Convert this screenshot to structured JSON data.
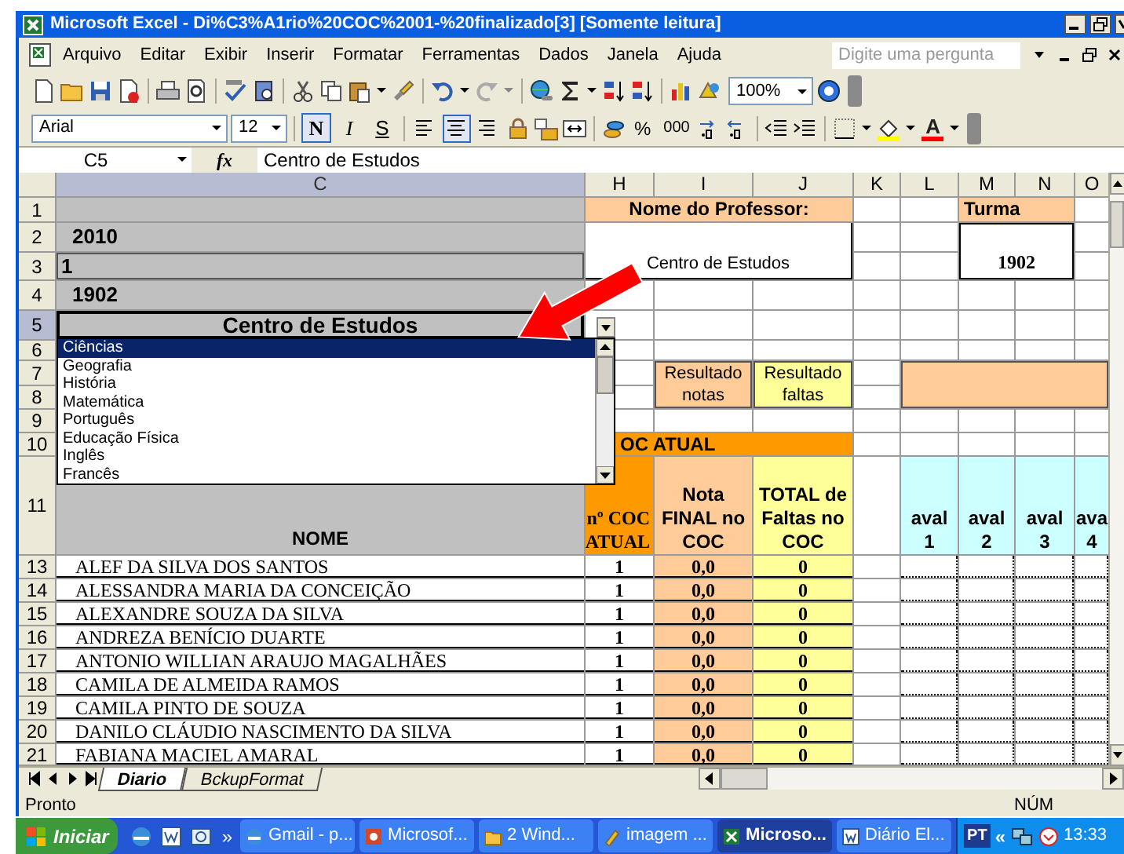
{
  "window": {
    "title": "Microsoft Excel - Di%C3%A1rio%20COC%2001-%20finalizado[3]  [Somente leitura]"
  },
  "menu": [
    "Arquivo",
    "Editar",
    "Exibir",
    "Inserir",
    "Formatar",
    "Ferramentas",
    "Dados",
    "Janela",
    "Ajuda"
  ],
  "help_box": {
    "placeholder": "Digite uma pergunta"
  },
  "standard_toolbar": {
    "zoom": "100%"
  },
  "format_toolbar": {
    "font": "Arial",
    "size": "12",
    "styles": [
      {
        "label": "N",
        "selected": true
      },
      {
        "label": "I",
        "selected": false
      },
      {
        "label": "S",
        "selected": false
      }
    ],
    "alignment": [
      {
        "selected": false
      },
      {
        "selected": true
      },
      {
        "selected": false
      }
    ],
    "percent": "%",
    "thousands": "000",
    "font_color": "A"
  },
  "formula_bar": {
    "name_box": "C5",
    "fx": "fx",
    "content": "Centro de Estudos"
  },
  "sheet": {
    "columns": [
      {
        "label": "C",
        "selected": true
      },
      {
        "label": "H",
        "selected": false
      },
      {
        "label": "I",
        "selected": false
      },
      {
        "label": "J",
        "selected": false
      },
      {
        "label": "K",
        "selected": false
      },
      {
        "label": "L",
        "selected": false
      },
      {
        "label": "M",
        "selected": false
      },
      {
        "label": "N",
        "selected": false
      },
      {
        "label": "O",
        "selected": false
      }
    ],
    "row_headers": [
      {
        "label": "1",
        "selected": false
      },
      {
        "label": "2",
        "selected": false
      },
      {
        "label": "3",
        "selected": false
      },
      {
        "label": "4",
        "selected": false
      },
      {
        "label": "5",
        "selected": true
      },
      {
        "label": "6",
        "selected": false
      },
      {
        "label": "7",
        "selected": false
      },
      {
        "label": "8",
        "selected": false
      },
      {
        "label": "9",
        "selected": false
      },
      {
        "label": "10",
        "selected": false
      },
      {
        "label": "11",
        "selected": false
      },
      {
        "label": "13",
        "selected": false
      },
      {
        "label": "14",
        "selected": false
      },
      {
        "label": "15",
        "selected": false
      },
      {
        "label": "16",
        "selected": false
      },
      {
        "label": "17",
        "selected": false
      },
      {
        "label": "18",
        "selected": false
      },
      {
        "label": "19",
        "selected": false
      },
      {
        "label": "20",
        "selected": false
      },
      {
        "label": "21",
        "selected": false
      }
    ],
    "year": "2010",
    "coc": "1",
    "class_code": "1902",
    "subject": "Centro de Estudos",
    "teacher_label": "Nome do Professor:",
    "teacher_value": "Centro de Estudos",
    "class_label": "Turma",
    "class_value": "1902",
    "result_grades": "Resultado notas",
    "result_absences": "Resultado faltas",
    "section_title": "OC ATUAL",
    "headers": {
      "name": "NOME",
      "coc": "nº COC ATUAL",
      "grade": "Nota FINAL no COC",
      "absences": "TOTAL de Faltas no COC",
      "evaluations": [
        {
          "line1": "aval",
          "line2": "1"
        },
        {
          "line1": "aval",
          "line2": "2"
        },
        {
          "line1": "aval",
          "line2": "3"
        },
        {
          "line1": "ava",
          "line2": "4"
        }
      ]
    },
    "students": [
      {
        "name": "ALEF DA SILVA DOS SANTOS",
        "coc": "1",
        "grade": "0,0",
        "absences": "0"
      },
      {
        "name": "ALESSANDRA MARIA DA CONCEIÇÃO",
        "coc": "1",
        "grade": "0,0",
        "absences": "0"
      },
      {
        "name": "ALEXANDRE SOUZA DA SILVA",
        "coc": "1",
        "grade": "0,0",
        "absences": "0"
      },
      {
        "name": "ANDREZA BENÍCIO DUARTE",
        "coc": "1",
        "grade": "0,0",
        "absences": "0"
      },
      {
        "name": "ANTONIO WILLIAN ARAUJO MAGALHÃES",
        "coc": "1",
        "grade": "0,0",
        "absences": "0"
      },
      {
        "name": "CAMILA DE ALMEIDA RAMOS",
        "coc": "1",
        "grade": "0,0",
        "absences": "0"
      },
      {
        "name": "CAMILA PINTO DE SOUZA",
        "coc": "1",
        "grade": "0,0",
        "absences": "0"
      },
      {
        "name": "DANILO CLÁUDIO NASCIMENTO DA SILVA",
        "coc": "1",
        "grade": "0,0",
        "absences": "0"
      },
      {
        "name": "FABIANA MACIEL AMARAL",
        "coc": "1",
        "grade": "0,0",
        "absences": "0"
      }
    ]
  },
  "dropdown": {
    "options": [
      {
        "label": "Ciências",
        "selected": true
      },
      {
        "label": "Geografia",
        "selected": false
      },
      {
        "label": "História",
        "selected": false
      },
      {
        "label": "Matemática",
        "selected": false
      },
      {
        "label": "Português",
        "selected": false
      },
      {
        "label": "Educação Física",
        "selected": false
      },
      {
        "label": "Inglês",
        "selected": false
      },
      {
        "label": "Francês",
        "selected": false
      }
    ]
  },
  "sheet_tabs": [
    {
      "label": "Diario",
      "selected": true
    },
    {
      "label": "BckupFormat",
      "selected": false
    }
  ],
  "status_bar": {
    "status": "Pronto",
    "num_lock": "NÚM"
  },
  "taskbar": {
    "start": "Iniciar",
    "overflow": "»",
    "tasks": [
      {
        "label": "Gmail - p...",
        "selected": false
      },
      {
        "label": "Microsof...",
        "selected": false
      },
      {
        "label": "2 Wind...",
        "selected": false
      },
      {
        "label": "imagem ...",
        "selected": false
      },
      {
        "label": "Microso...",
        "selected": true
      },
      {
        "label": "Diário El...",
        "selected": false
      }
    ],
    "language": "PT",
    "tray_toggle": "«",
    "clock": "13:33"
  }
}
